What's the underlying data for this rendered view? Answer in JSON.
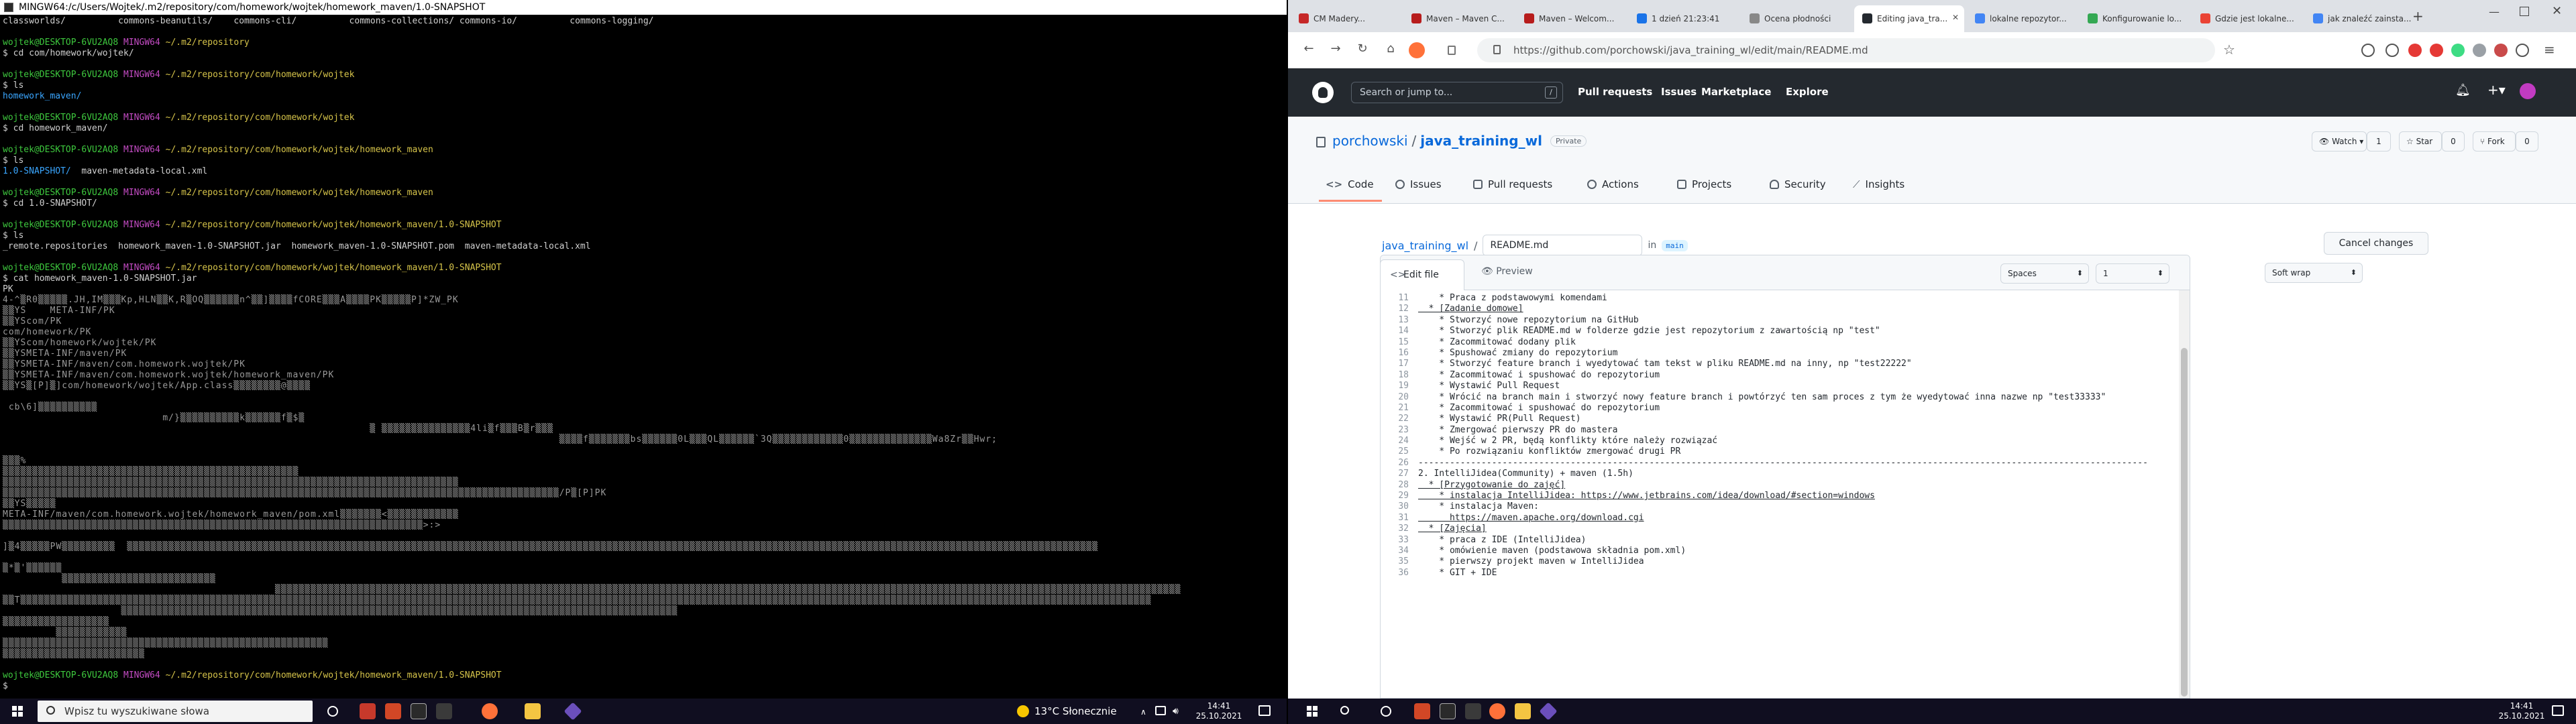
{
  "terminal": {
    "title": "MINGW64:/c/Users/Wojtek/.m2/repository/com/homework/wojtek/homework_maven/1.0-SNAPSHOT",
    "lines": [
      {
        "t": "plain",
        "text": "classworlds/          commons-beanutils/    commons-cli/          commons-collections/ commons-io/          commons-logging/"
      },
      {
        "t": "blank"
      },
      {
        "t": "prompt",
        "user": "wojtek@DESKTOP-6VU2AQ8",
        "shell": "MINGW64",
        "path": "~/.m2/repository"
      },
      {
        "t": "plain",
        "text": "$ cd com/homework/wojtek/"
      },
      {
        "t": "blank"
      },
      {
        "t": "prompt",
        "user": "wojtek@DESKTOP-6VU2AQ8",
        "shell": "MINGW64",
        "path": "~/.m2/repository/com/homework/wojtek"
      },
      {
        "t": "plain",
        "text": "$ ls"
      },
      {
        "t": "dir",
        "text": "homework_maven/"
      },
      {
        "t": "blank"
      },
      {
        "t": "prompt",
        "user": "wojtek@DESKTOP-6VU2AQ8",
        "shell": "MINGW64",
        "path": "~/.m2/repository/com/homework/wojtek"
      },
      {
        "t": "plain",
        "text": "$ cd homework_maven/"
      },
      {
        "t": "blank"
      },
      {
        "t": "prompt",
        "user": "wojtek@DESKTOP-6VU2AQ8",
        "shell": "MINGW64",
        "path": "~/.m2/repository/com/homework/wojtek/homework_maven"
      },
      {
        "t": "plain",
        "text": "$ ls"
      },
      {
        "t": "dirmix",
        "dir": "1.0-SNAPSHOT/",
        "rest": "  maven-metadata-local.xml"
      },
      {
        "t": "blank"
      },
      {
        "t": "prompt",
        "user": "wojtek@DESKTOP-6VU2AQ8",
        "shell": "MINGW64",
        "path": "~/.m2/repository/com/homework/wojtek/homework_maven"
      },
      {
        "t": "plain",
        "text": "$ cd 1.0-SNAPSHOT/"
      },
      {
        "t": "blank"
      },
      {
        "t": "prompt",
        "user": "wojtek@DESKTOP-6VU2AQ8",
        "shell": "MINGW64",
        "path": "~/.m2/repository/com/homework/wojtek/homework_maven/1.0-SNAPSHOT"
      },
      {
        "t": "plain",
        "text": "$ ls"
      },
      {
        "t": "plain",
        "text": "_remote.repositories  homework_maven-1.0-SNAPSHOT.jar  homework_maven-1.0-SNAPSHOT.pom  maven-metadata-local.xml"
      },
      {
        "t": "blank"
      },
      {
        "t": "prompt",
        "user": "wojtek@DESKTOP-6VU2AQ8",
        "shell": "MINGW64",
        "path": "~/.m2/repository/com/homework/wojtek/homework_maven/1.0-SNAPSHOT"
      },
      {
        "t": "plain",
        "text": "$ cat homework_maven-1.0-SNAPSHOT.jar"
      },
      {
        "t": "plain",
        "text": "PK"
      },
      {
        "t": "garb",
        "text": "4-^▒R0▒▒▒▒▒.JH,IM▒▒▒Kp,HLN▒▒K,R▒OQ▒▒▒▒▒▒n^▒▒]▒▒▒▒fCORE▒▒▒A▒▒▒▒PK▒▒▒▒▒P]*ZW_PK"
      },
      {
        "t": "garb",
        "text": "▒▒YS    META-INF/PK"
      },
      {
        "t": "garb",
        "text": "▒▒YScom/PK"
      },
      {
        "t": "garb",
        "text": "com/homework/PK"
      },
      {
        "t": "garb",
        "text": "▒▒YScom/homework/wojtek/PK"
      },
      {
        "t": "garb",
        "text": "▒▒YSMETA-INF/maven/PK"
      },
      {
        "t": "garb",
        "text": "▒▒YSMETA-INF/maven/com.homework.wojtek/PK"
      },
      {
        "t": "garb",
        "text": "▒▒YSMETA-INF/maven/com.homework.wojtek/homework_maven/PK"
      },
      {
        "t": "garb",
        "text": "▒▒YS▒[P]▒]com/homework/wojtek/App.class▒▒▒▒▒▒▒▒@▒▒▒▒"
      },
      {
        "t": "blank"
      },
      {
        "t": "garb",
        "text": " cb\\6]▒▒▒▒▒▒▒▒▒▒"
      },
      {
        "t": "garb",
        "text": "                           m/}▒▒▒▒▒▒▒▒▒▒k▒▒▒▒▒▒f▒$▒"
      },
      {
        "t": "garb",
        "text": "                                                              ▒ ▒▒▒▒▒▒▒▒▒▒▒▒▒▒▒4li▒f▒▒▒B▒r▒▒▒"
      },
      {
        "t": "garb",
        "text": "                                                                                              ▒▒▒▒f▒▒▒▒▒▒▒bs▒▒▒▒▒▒0L▒▒▒QL▒▒▒▒▒▒`3Q▒▒▒▒▒▒▒▒▒▒▒▒0▒▒▒▒▒▒▒▒▒▒▒▒▒▒Wa8Zr▒▒Hwr;"
      },
      {
        "t": "blank"
      },
      {
        "t": "garb",
        "text": "▒▒▒%"
      },
      {
        "t": "garb",
        "text": "▒▒▒▒▒▒▒▒▒▒▒▒▒▒▒▒▒▒▒▒▒▒▒▒▒▒▒▒▒▒▒▒▒▒▒▒▒▒▒▒▒▒▒▒▒▒▒▒▒▒"
      },
      {
        "t": "garb",
        "text": "▒▒▒▒▒▒▒▒▒▒▒▒▒▒▒▒▒▒▒▒▒▒▒▒▒▒▒▒▒▒▒▒▒▒▒▒▒▒▒▒▒▒▒▒▒▒▒▒▒▒▒▒▒▒▒▒▒▒▒▒▒▒▒▒▒▒▒▒▒▒▒▒▒▒▒▒▒"
      },
      {
        "t": "garb",
        "text": "▒▒▒▒▒▒▒▒▒▒▒▒▒▒▒▒▒▒▒▒▒▒▒▒▒▒▒▒▒▒▒▒▒▒▒▒▒▒▒▒▒▒▒▒▒▒▒▒▒▒▒▒▒▒▒▒▒▒▒▒▒▒▒▒▒▒▒▒▒▒▒▒▒▒▒▒▒▒▒▒▒▒▒▒▒▒▒▒▒▒▒▒▒▒/P▒[P]PK"
      },
      {
        "t": "garb",
        "text": "▒▒YS▒▒▒▒▒"
      },
      {
        "t": "garb",
        "text": "META-INF/maven/com.homework.wojtek/homework_maven/pom.xml▒▒▒▒▒▒▒<▒▒▒▒▒▒▒▒▒▒▒▒"
      },
      {
        "t": "garb",
        "text": "▒▒▒▒▒▒▒▒▒▒▒▒▒▒▒▒▒▒▒▒▒▒▒▒▒▒▒▒▒▒▒▒▒▒▒▒▒▒▒▒▒▒▒▒▒▒▒▒▒▒▒▒▒▒▒▒▒▒▒▒▒▒▒▒▒▒▒▒▒▒▒>:>"
      },
      {
        "t": "blank"
      },
      {
        "t": "garb",
        "text": "]▒4▒▒▒▒▒PW▒▒▒▒▒▒▒▒▒  ▒▒▒▒▒▒▒▒▒▒▒▒▒▒▒▒▒▒▒▒▒▒▒▒▒▒▒▒▒▒▒▒▒▒▒▒▒▒▒▒▒▒▒▒▒▒▒▒▒▒▒▒▒▒▒▒▒▒▒▒▒▒▒▒▒▒▒▒▒▒▒▒▒▒▒▒▒▒▒▒▒▒▒▒▒▒▒▒▒▒▒▒▒▒▒▒▒▒▒▒▒▒▒▒▒▒▒▒▒▒▒▒▒▒▒▒▒▒▒▒▒▒▒▒▒▒▒▒▒▒▒▒▒▒▒▒▒▒▒▒▒▒▒▒▒▒▒▒▒▒▒▒▒▒▒▒▒▒▒▒▒▒▒▒"
      },
      {
        "t": "blank"
      },
      {
        "t": "garb",
        "text": "▒*▒'▒▒▒▒▒▒"
      },
      {
        "t": "garb",
        "text": "          ▒▒▒▒▒▒▒▒▒▒▒▒▒▒▒▒▒▒▒▒▒▒▒▒▒▒"
      },
      {
        "t": "garb",
        "text": "                                              ▒▒▒▒▒▒▒▒▒▒▒▒▒▒▒▒▒▒▒▒▒▒▒▒▒▒▒▒▒▒▒▒▒▒▒▒▒▒▒▒▒▒▒▒▒▒▒▒▒▒▒▒▒▒▒▒▒▒▒▒▒▒▒▒▒▒▒▒▒▒▒▒▒▒▒▒▒▒▒▒▒▒▒▒▒▒▒▒▒▒▒▒▒▒▒▒▒▒▒▒▒▒▒▒▒▒▒▒▒▒▒▒▒▒▒▒▒▒▒▒▒▒▒▒▒▒▒▒▒▒▒▒▒▒▒▒▒▒▒▒▒▒▒▒▒▒▒▒▒▒▒▒▒"
      },
      {
        "t": "garb",
        "text": "▒▒T▒▒▒▒▒▒▒▒▒▒▒▒▒▒▒▒▒▒▒▒▒▒▒▒▒▒▒▒▒▒▒▒▒▒▒▒▒▒▒▒▒▒▒▒▒▒▒▒▒▒▒▒▒▒▒▒▒▒▒▒▒▒▒▒▒▒▒▒▒▒▒▒▒▒▒▒▒▒▒▒▒▒▒▒▒▒▒▒▒▒▒▒▒▒▒▒▒▒▒▒▒▒▒▒▒▒▒▒▒▒▒▒▒▒▒▒▒▒▒▒▒▒▒▒▒▒▒▒▒▒▒▒▒▒▒▒▒▒▒▒▒▒▒▒▒▒▒▒▒▒▒▒▒▒▒▒▒▒▒▒▒▒▒▒▒▒▒▒▒▒▒▒▒▒▒▒▒▒▒▒▒▒▒▒▒▒▒▒▒▒▒"
      },
      {
        "t": "garb",
        "text": "                    ▒▒▒▒▒▒▒▒▒▒▒▒▒▒▒▒▒▒▒▒▒▒▒▒▒▒▒▒▒▒▒▒▒▒▒▒▒▒▒▒▒▒▒▒▒▒▒▒▒▒▒▒▒▒▒▒▒▒▒▒▒▒▒▒▒▒▒▒▒▒▒▒▒▒▒▒▒▒▒▒▒▒▒▒▒▒▒▒▒▒▒▒▒▒"
      },
      {
        "t": "garb",
        "text": "▒▒▒▒▒▒▒▒▒▒▒▒▒▒▒▒▒▒"
      },
      {
        "t": "garb",
        "text": "         ▒▒▒▒▒▒▒▒▒▒▒▒"
      },
      {
        "t": "garb",
        "text": "▒▒▒▒▒▒▒▒▒▒▒▒▒▒▒▒▒▒▒▒▒▒▒▒▒▒▒▒▒▒▒▒▒▒▒▒▒▒▒▒▒▒▒▒▒▒▒▒▒▒▒▒▒▒▒"
      },
      {
        "t": "garb",
        "text": "▒▒▒▒▒▒▒▒▒▒▒▒▒▒▒▒▒▒▒▒▒▒▒▒"
      },
      {
        "t": "blank"
      },
      {
        "t": "prompt",
        "user": "wojtek@DESKTOP-6VU2AQ8",
        "shell": "MINGW64",
        "path": "~/.m2/repository/com/homework/wojtek/homework_maven/1.0-SNAPSHOT"
      },
      {
        "t": "plain",
        "text": "$ "
      }
    ]
  },
  "taskbar_left": {
    "search_placeholder": "Wpisz tu wyszukiwane słowa",
    "weather": "13°C  Słonecznie",
    "time": "14:41",
    "date": "25.10.2021"
  },
  "taskbar_right": {
    "time": "14:41",
    "date": "25.10.2021"
  },
  "browser": {
    "tabs": [
      {
        "label": "CM Madery...",
        "color": "#c62828"
      },
      {
        "label": "Maven – Maven C...",
        "color": "#b71c1c"
      },
      {
        "label": "Maven – Welcom...",
        "color": "#b71c1c"
      },
      {
        "label": "1 dzień 21:23:41",
        "color": "#1a73e8"
      },
      {
        "label": "Ocena płodności",
        "color": "#888888"
      },
      {
        "label": "Editing java_tra...",
        "color": "#24292f",
        "active": true
      },
      {
        "label": "lokalne repozytor...",
        "color": "#4285f4"
      },
      {
        "label": "Konfigurowanie lo...",
        "color": "#34a853"
      },
      {
        "label": "Gdzie jest lokalne...",
        "color": "#ea4335"
      },
      {
        "label": "jak znaleźć zainsta...",
        "color": "#4285f4"
      }
    ],
    "url": "https://github.com/porchowski/java_training_wl/edit/main/README.md",
    "github": {
      "search_placeholder": "Search or jump to...",
      "nav": [
        "Pull requests",
        "Issues",
        "Marketplace",
        "Explore"
      ],
      "owner": "porchowski",
      "repo": "java_training_wl",
      "visibility": "Private",
      "watch_label": "Watch",
      "watch_count": "1",
      "star_label": "Star",
      "star_count": "0",
      "fork_label": "Fork",
      "fork_count": "0",
      "repo_tabs": [
        "Code",
        "Issues",
        "Pull requests",
        "Actions",
        "Projects",
        "Security",
        "Insights"
      ],
      "breadcrumb_repo": "java_training_wl",
      "filename": "README.md",
      "branch_in": "in",
      "branch": "main",
      "cancel_label": "Cancel changes",
      "edit_tab": "Edit file",
      "preview_tab": "Preview",
      "indent_mode": "Spaces",
      "indent_size": "1",
      "wrap_mode": "Soft wrap",
      "code_lines": [
        {
          "n": "11",
          "text": "    * Praca z podstawowymi komendami"
        },
        {
          "n": "12",
          "text": "  * [Zadanie domowe]"
        },
        {
          "n": "13",
          "text": "    * Stworzyć nowe repozytorium na GitHub"
        },
        {
          "n": "14",
          "text": "    * Stworzyć plik README.md w folderze gdzie jest repozytorium z zawartością np \"test\""
        },
        {
          "n": "15",
          "text": "    * Zacommitować dodany plik"
        },
        {
          "n": "16",
          "text": "    * Spushować zmiany do repozytorium"
        },
        {
          "n": "17",
          "text": "    * Stworzyć feature branch i wyedytować tam tekst w pliku README.md na inny, np \"test22222\""
        },
        {
          "n": "18",
          "text": "    * Zacommitować i spushować do repozytorium"
        },
        {
          "n": "19",
          "text": "    * Wystawić Pull Request"
        },
        {
          "n": "20",
          "text": "    * Wrócić na branch main i stworzyć nowy feature branch i powtórzyć ten sam proces z tym że wyedytować inna nazwe np \"test33333\""
        },
        {
          "n": "21",
          "text": "    * Zacommitować i spushować do repozytorium"
        },
        {
          "n": "22",
          "text": "    * Wystawić PR(Pull Request)"
        },
        {
          "n": "23",
          "text": "    * Zmergować pierwszy PR do mastera"
        },
        {
          "n": "24",
          "text": "    * Wejść w 2 PR, będą konflikty które należy rozwiązać"
        },
        {
          "n": "25",
          "text": "    * Po rozwiązaniu konfliktów zmergować drugi PR"
        },
        {
          "n": "26",
          "text": "-------------------------------------------------------------------------------------------------------------------------------------------"
        },
        {
          "n": "27",
          "text": "2. IntelliJidea(Community) + maven (1.5h)"
        },
        {
          "n": "28",
          "text": "  * [Przygotowanie do zajęć]"
        },
        {
          "n": "29",
          "text": "    * instalacja IntelliJidea: https://www.jetbrains.com/idea/download/#section=windows"
        },
        {
          "n": "30",
          "text": "    * instalacja Maven:"
        },
        {
          "n": "31",
          "text": "      https://maven.apache.org/download.cgi"
        },
        {
          "n": "32",
          "text": "  * [Zajęcia]"
        },
        {
          "n": "33",
          "text": "    * praca z IDE (IntelliJidea)"
        },
        {
          "n": "34",
          "text": "    * omówienie maven (podstawowa składnia pom.xml)"
        },
        {
          "n": "35",
          "text": "    * pierwszy projekt maven w IntelliJidea"
        },
        {
          "n": "36",
          "text": "    * GIT + IDE"
        }
      ]
    }
  }
}
